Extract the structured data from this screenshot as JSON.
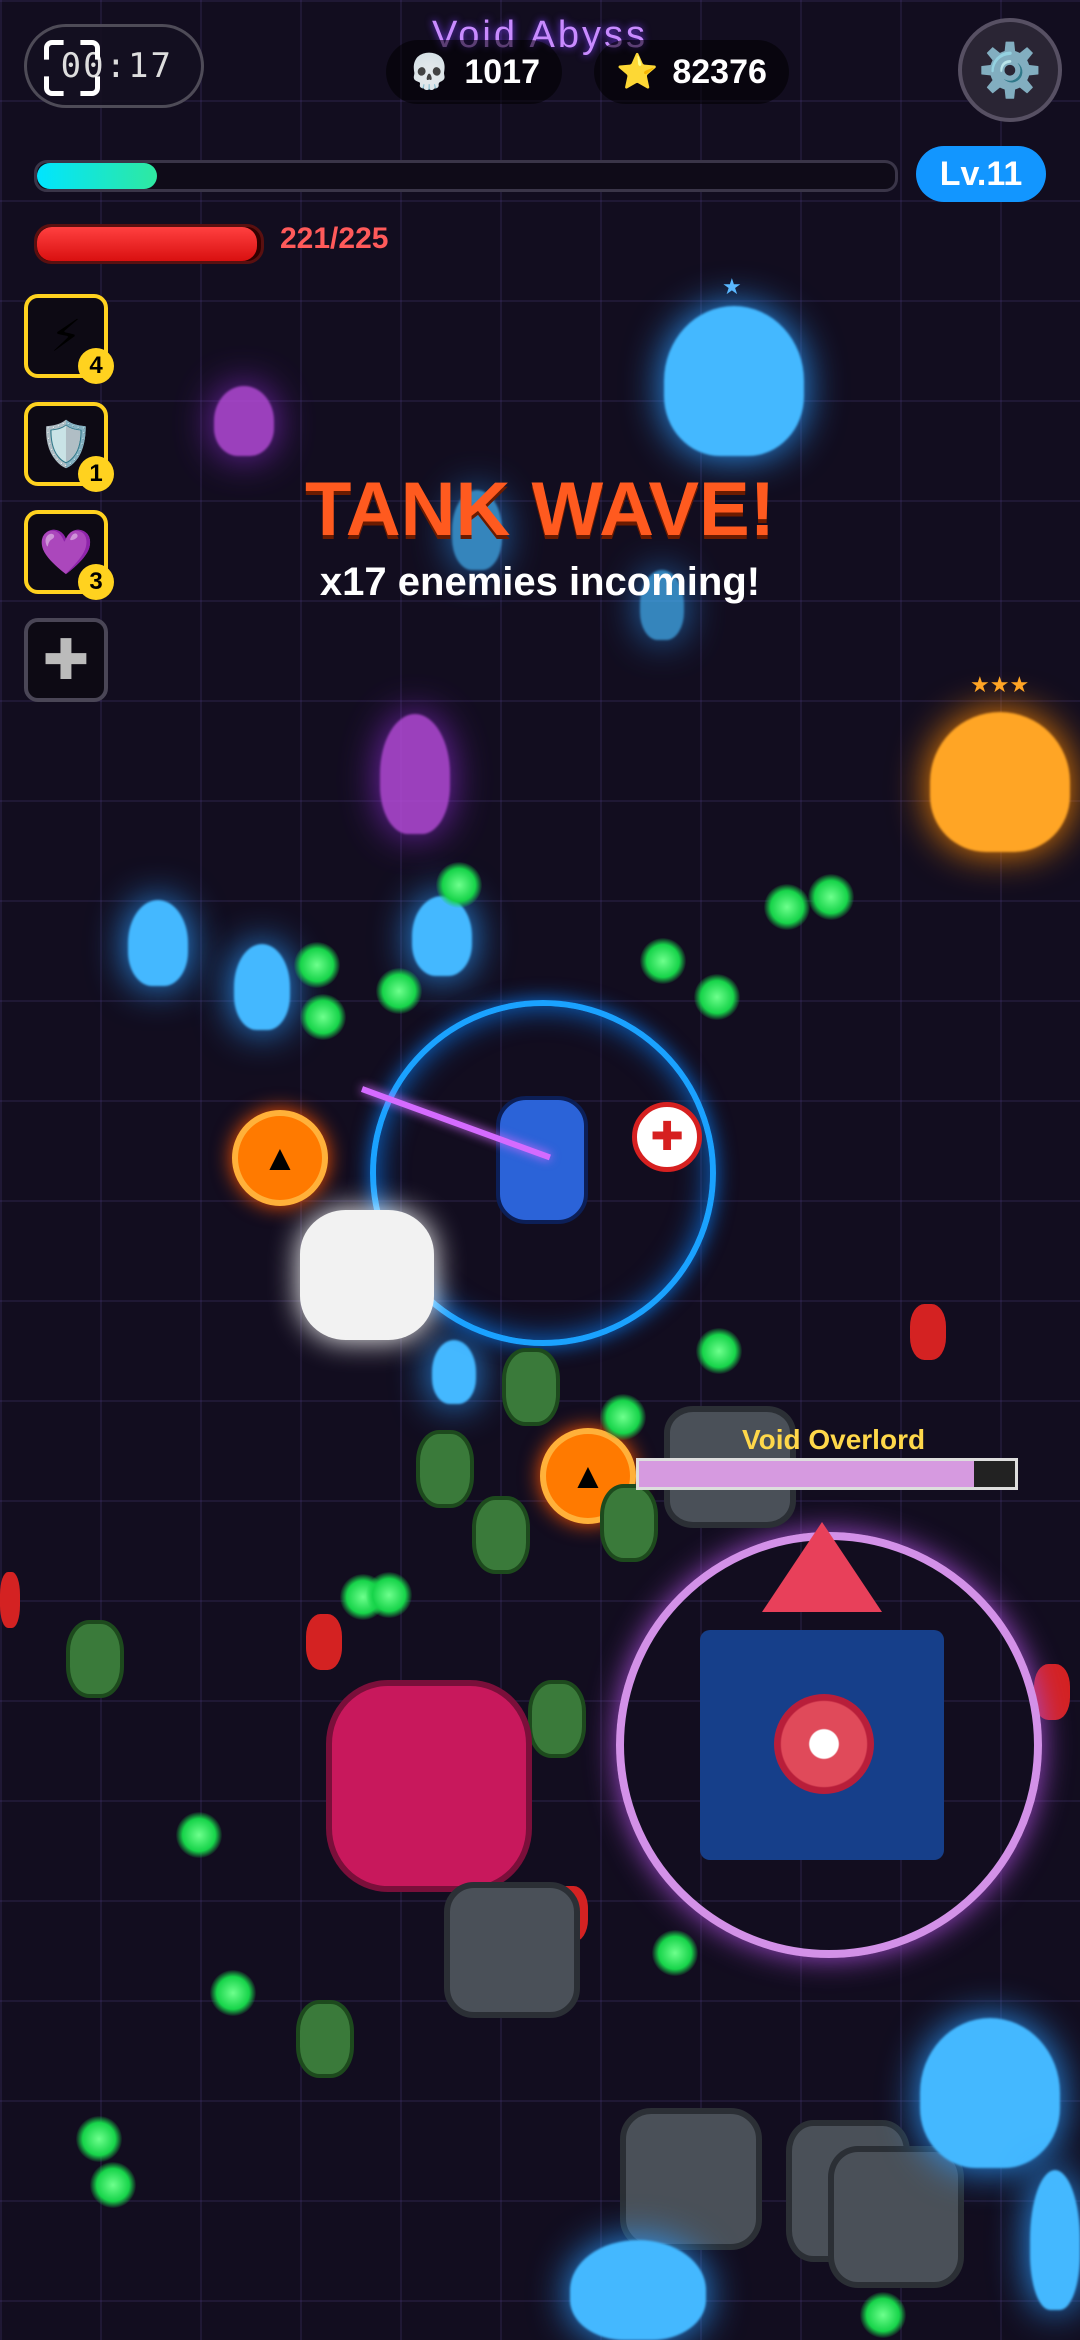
{
  "hud": {
    "timer": "00:17",
    "title": "Void Abyss",
    "kills": "1017",
    "score": "82376",
    "level": "Lv.11",
    "xp_progress": 0.14,
    "hp_text": "221/225",
    "hp_progress": 0.982
  },
  "icons": {
    "kills_icon": "💀",
    "score_icon": "⭐",
    "settings_icon": "⚙️"
  },
  "skills": [
    {
      "icon": "⚡",
      "count": "4"
    },
    {
      "icon": "🛡️",
      "count": "1"
    },
    {
      "icon": "💜",
      "count": "3"
    },
    {
      "icon": "✚",
      "count": ""
    }
  ],
  "announcement": {
    "title": "TANK WAVE!",
    "subtitle": "x17 enemies incoming!"
  },
  "boss": {
    "name": "Void Overlord",
    "health": 0.89
  },
  "colors": {
    "accent": "#1296ff",
    "hp": "#ff3b3b",
    "wave": "#ff5a1f",
    "xp": "#00e5ff",
    "boss_name": "#ffd84a"
  }
}
